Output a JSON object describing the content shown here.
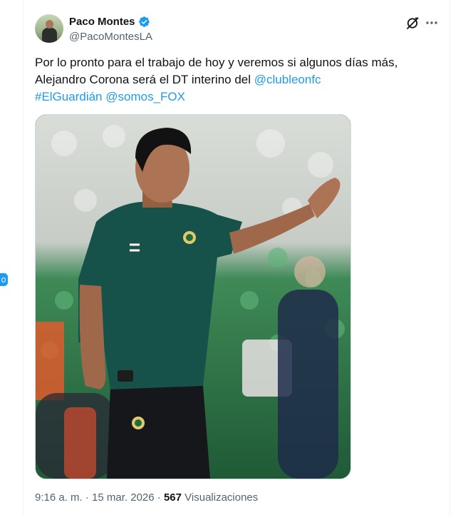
{
  "author": {
    "name": "Paco Montes",
    "handle": "@PacoMontesLA",
    "verified": true
  },
  "tweet": {
    "line1": "Por lo pronto para el trabajo de hoy y veremos si algunos días más,",
    "line2_text": "Alejandro Corona será el DT interino del ",
    "mention_club": "@clubleonfc",
    "hashtag": "#ElGuardián",
    "mention_fox": "@somos_FOX"
  },
  "media": {
    "icon": "photo-coach-pointing"
  },
  "meta": {
    "time": "9:16 a. m.",
    "separator": " · ",
    "date": "15 mar. 2026",
    "views_count": "567",
    "views_label": "Visualizaciones"
  },
  "icons": {
    "grok": "grok-icon",
    "more": "more-dots-icon",
    "verified": "verified-badge-icon"
  },
  "colors": {
    "link": "#1d9bf0",
    "secondary_text": "#536471",
    "primary_text": "#0f1419"
  }
}
